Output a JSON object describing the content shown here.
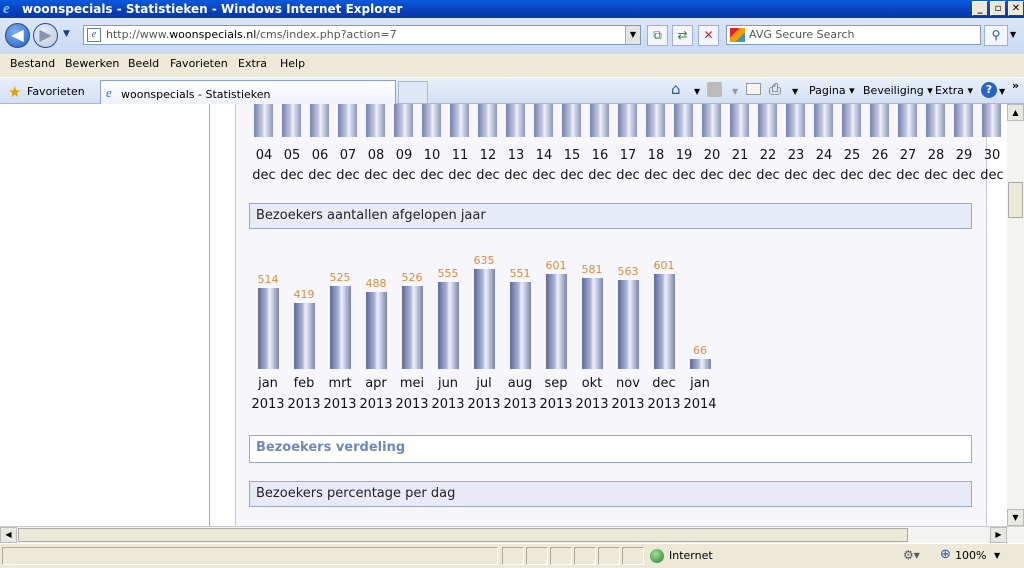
{
  "window": {
    "title": "woonspecials - Statistieken - Windows Internet Explorer"
  },
  "address": {
    "url_prefix": "http://www.",
    "url_domain": "woonspecials.nl",
    "url_path": "/cms/index.php?action=7"
  },
  "search": {
    "placeholder": "AVG Secure Search"
  },
  "menu": [
    "Bestand",
    "Bewerken",
    "Beeld",
    "Favorieten",
    "Extra",
    "Help"
  ],
  "favorites": {
    "label": "Favorieten",
    "tab_title": "woonspecials - Statistieken"
  },
  "commands": {
    "page": "Pagina ▾",
    "security": "Beveiliging ▾",
    "extra": "Extra ▾"
  },
  "daily": {
    "days": [
      "04",
      "05",
      "06",
      "07",
      "08",
      "09",
      "10",
      "11",
      "12",
      "13",
      "14",
      "15",
      "16",
      "17",
      "18",
      "19",
      "20",
      "21",
      "22",
      "23",
      "24",
      "25",
      "26",
      "27",
      "28",
      "29",
      "30"
    ],
    "month": "dec"
  },
  "sections": {
    "year_title": "Bezoekers aantallen afgelopen jaar",
    "distribution": "Bezoekers verdeling",
    "per_day": "Bezoekers percentage per dag"
  },
  "chart_data": {
    "type": "bar",
    "title": "Bezoekers aantallen afgelopen jaar",
    "categories": [
      "jan 2013",
      "feb 2013",
      "mrt 2013",
      "apr 2013",
      "mei 2013",
      "jun 2013",
      "jul 2013",
      "aug 2013",
      "sep 2013",
      "okt 2013",
      "nov 2013",
      "dec 2013",
      "jan 2014"
    ],
    "months": [
      "jan",
      "feb",
      "mrt",
      "apr",
      "mei",
      "jun",
      "jul",
      "aug",
      "sep",
      "okt",
      "nov",
      "dec",
      "jan"
    ],
    "years": [
      "2013",
      "2013",
      "2013",
      "2013",
      "2013",
      "2013",
      "2013",
      "2013",
      "2013",
      "2013",
      "2013",
      "2013",
      "2014"
    ],
    "values": [
      514,
      419,
      525,
      488,
      526,
      555,
      635,
      551,
      601,
      581,
      563,
      601,
      66
    ],
    "value_labels": [
      "514",
      "419",
      "525",
      "488",
      "526",
      "555",
      "635",
      "551",
      "601",
      "581",
      "563",
      "601",
      "66"
    ],
    "bar_color": "#8a94bd",
    "label_color": "#e08a3e"
  },
  "status": {
    "zone": "Internet",
    "zoom": "100%"
  }
}
